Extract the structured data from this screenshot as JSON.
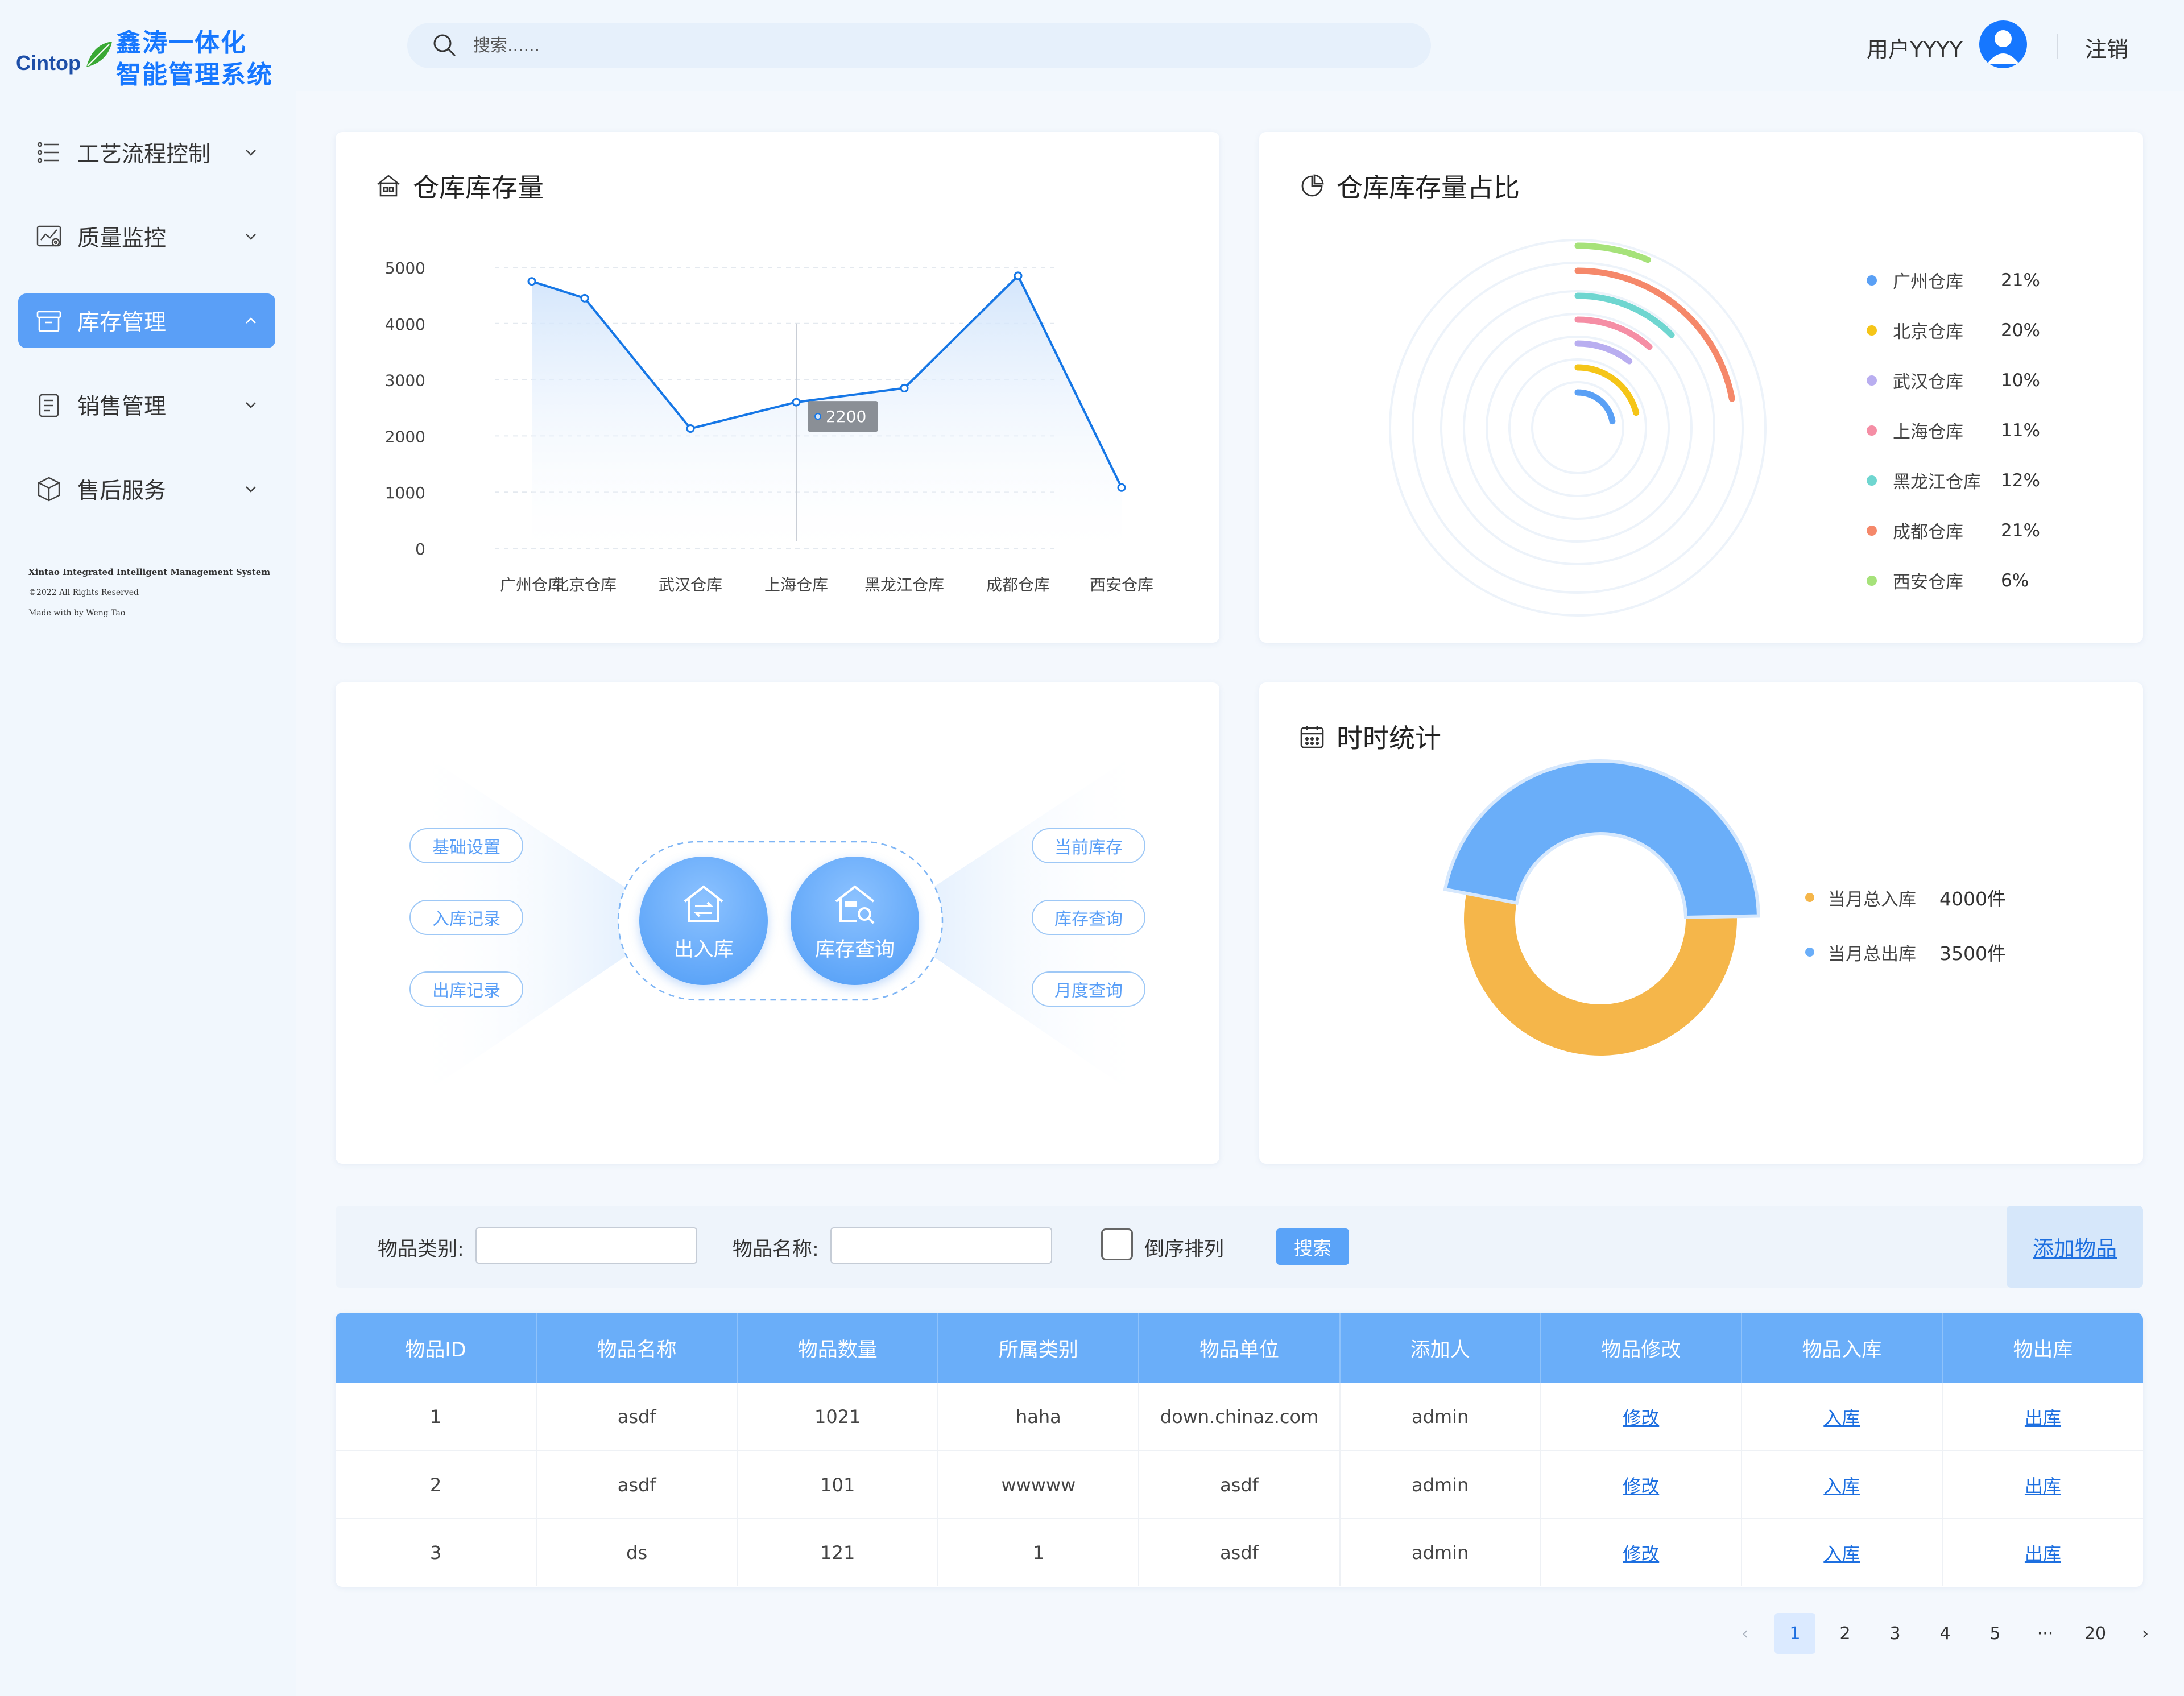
{
  "brand": {
    "logo_word": "Cintop",
    "title_line1": "鑫涛一体化",
    "title_line2": "智能管理系统"
  },
  "sidebar": {
    "items": [
      {
        "label": "工艺流程控制",
        "icon": "process-list-icon",
        "active": false
      },
      {
        "label": "质量监控",
        "icon": "quality-chart-icon",
        "active": false
      },
      {
        "label": "库存管理",
        "icon": "inventory-box-icon",
        "active": true
      },
      {
        "label": "销售管理",
        "icon": "sales-clipboard-icon",
        "active": false
      },
      {
        "label": "售后服务",
        "icon": "service-cube-icon",
        "active": false
      }
    ],
    "footer": {
      "line1": "Xintao Integrated Intelligent Management System",
      "line2": "©2022 All Rights Reserved",
      "line3": "Made with by Weng Tao"
    }
  },
  "header": {
    "search_placeholder": "搜索......",
    "user_name": "用户YYYY",
    "logout": "注销"
  },
  "cards": {
    "stock": {
      "title": "仓库库存量",
      "tooltip": "2200"
    },
    "ratio": {
      "title": "仓库库存量占比"
    },
    "quick": {
      "left": [
        "基础设置",
        "入库记录",
        "出库记录"
      ],
      "center": [
        "出入库",
        "库存查询"
      ],
      "right": [
        "当前库存",
        "库存查询",
        "月度查询"
      ]
    },
    "stats": {
      "title": "时时统计"
    }
  },
  "chart_data": [
    {
      "type": "line",
      "categories": [
        "广州仓库",
        "北京仓库",
        "武汉仓库",
        "上海仓库",
        "黑龙江仓库",
        "成都仓库",
        "西安仓库"
      ],
      "values": [
        4750,
        4450,
        2130,
        2600,
        2850,
        4850,
        1080
      ],
      "ylim": [
        0,
        5000
      ],
      "yticks": [
        0,
        1000,
        2000,
        3000,
        4000,
        5000
      ],
      "tooltip_value": 2200,
      "color": "#1677e6"
    },
    {
      "type": "pie",
      "variant": "radial-arc",
      "labels": [
        "广州仓库",
        "北京仓库",
        "武汉仓库",
        "上海仓库",
        "黑龙江仓库",
        "成都仓库",
        "西安仓库"
      ],
      "display_values": [
        "21%",
        "20%",
        "10%",
        "11%",
        "12%",
        "21%",
        "6%"
      ],
      "values": [
        21,
        20,
        10,
        11,
        12,
        21,
        6
      ],
      "colors": [
        "#5aa0f5",
        "#f5c518",
        "#b9aef0",
        "#f58ea5",
        "#6fd6d0",
        "#f5886a",
        "#a6e27a"
      ]
    },
    {
      "type": "pie",
      "variant": "donut",
      "labels": [
        "当月总入库",
        "当月总出库"
      ],
      "display_values": [
        "4000件",
        "3500件"
      ],
      "values": [
        4000,
        3500
      ],
      "colors": [
        "#f5b64a",
        "#6aaef9"
      ]
    }
  ],
  "filter": {
    "category_label": "物品类别:",
    "name_label": "物品名称:",
    "reverse_label": "倒序排列",
    "search_button": "搜索",
    "add_button": "添加物品"
  },
  "table": {
    "headers": [
      "物品ID",
      "物品名称",
      "物品数量",
      "所属类别",
      "物品单位",
      "添加人",
      "物品修改",
      "物品入库",
      "物出库"
    ],
    "rows": [
      [
        "1",
        "asdf",
        "1021",
        "haha",
        "down.chinaz.com",
        "admin",
        "修改",
        "入库",
        "出库"
      ],
      [
        "2",
        "asdf",
        "101",
        "wwwww",
        "asdf",
        "admin",
        "修改",
        "入库",
        "出库"
      ],
      [
        "3",
        "ds",
        "121",
        "1",
        "asdf",
        "admin",
        "修改",
        "入库",
        "出库"
      ]
    ]
  },
  "pagination": {
    "prev": "‹",
    "pages": [
      "1",
      "2",
      "3",
      "4",
      "5",
      "···",
      "20"
    ],
    "current": "1",
    "next": "›"
  }
}
